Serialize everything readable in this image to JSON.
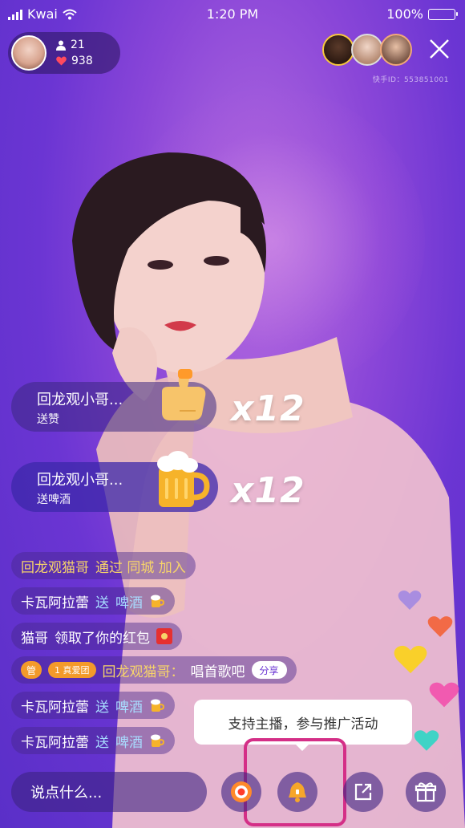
{
  "status_bar": {
    "carrier": "Kwai",
    "time": "1:20 PM",
    "battery": "100%"
  },
  "host": {
    "viewers_count": "21",
    "likes_count": "938"
  },
  "header": {
    "close_icon": "close-icon",
    "kwai_id": "快手ID：553851001"
  },
  "gift_bubbles": [
    {
      "name": "回龙观小哥...",
      "action": "送赞",
      "combo": "x12",
      "icon": "thumbs-up-icon"
    },
    {
      "name": "回龙观小哥...",
      "action": "送啤酒",
      "combo": "x12",
      "icon": "beer-mug-icon"
    }
  ],
  "comments": [
    {
      "user": "回龙观猫哥",
      "text": "通过 同城 加入"
    },
    {
      "user": "卡瓦阿拉蕾",
      "verb": "送",
      "gift": "啤酒"
    },
    {
      "user": "猫哥",
      "text": "领取了你的红包"
    },
    {
      "badge": "管",
      "fan_badge": "1 真爱团",
      "user": "回龙观猫哥：",
      "text": "唱首歌吧",
      "share": "分享"
    },
    {
      "user": "卡瓦阿拉蕾",
      "verb": "送",
      "gift": "啤酒"
    },
    {
      "user": "卡瓦阿拉蕾",
      "verb": "送",
      "gift": "啤酒"
    }
  ],
  "tooltip": {
    "text": "支持主播，参与推广活动"
  },
  "bottom_bar": {
    "input_placeholder": "说点什么...",
    "buttons": [
      "record-icon",
      "bell-icon",
      "share-icon",
      "gift-icon"
    ]
  },
  "colors": {
    "accent_purple": "#6b35d3",
    "gold_name": "#f7d46a",
    "cyan_name": "#a8dcff",
    "highlight": "#d42f87",
    "badge_orange": "#f39a2a"
  }
}
